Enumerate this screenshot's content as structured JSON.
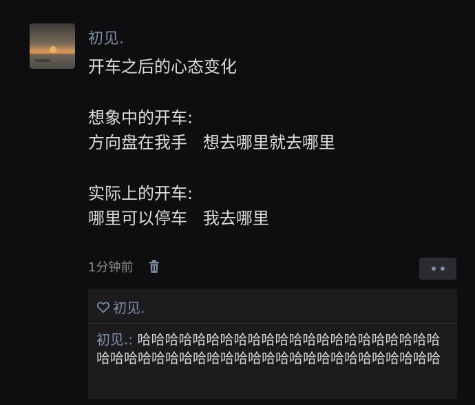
{
  "post": {
    "username": "初见.",
    "lines": [
      "开车之后的心态变化",
      "",
      "想象中的开车:",
      "方向盘在我手   想去哪里就去哪里",
      "",
      "实际上的开车:",
      "哪里可以停车   我去哪里"
    ],
    "timestamp": "1分钟前"
  },
  "icons": {
    "delete": "trash-icon",
    "more": "more-dots-icon",
    "like": "heart-icon"
  },
  "likes": {
    "names": "初见."
  },
  "comment": {
    "author": "初见.",
    "separator": ": ",
    "text": "哈哈哈哈哈哈哈哈哈哈哈哈哈哈哈哈哈哈哈哈哈哈哈哈哈哈哈哈哈哈哈哈哈哈哈哈哈哈哈哈哈哈哈哈哈哈哈"
  },
  "colors": {
    "background": "#0e0e10",
    "name_link": "#7f8fa8",
    "panel": "#1c1c1e"
  }
}
